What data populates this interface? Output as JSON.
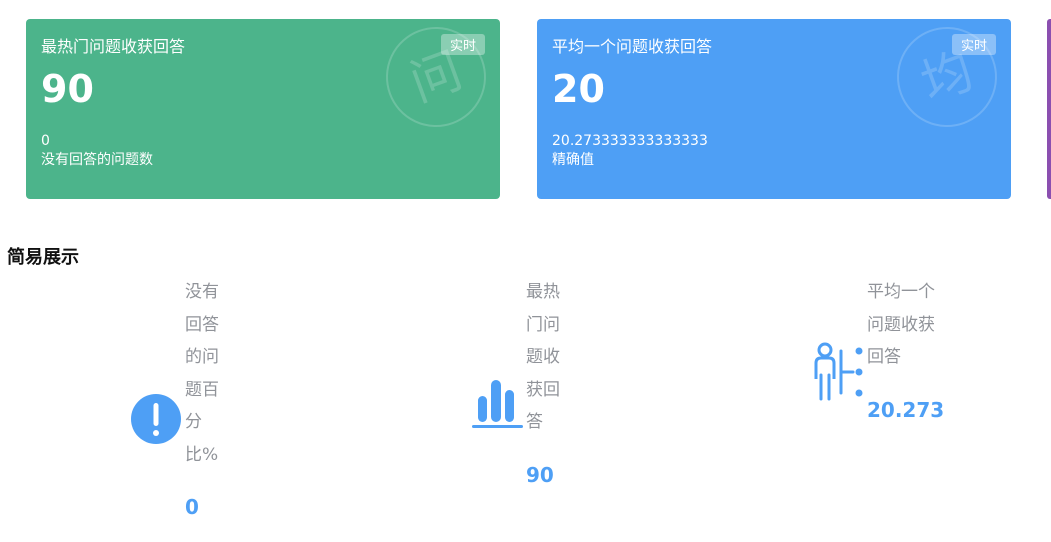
{
  "cards": [
    {
      "title": "最热门问题收获回答",
      "badge": "实时",
      "value": "90",
      "sub_value": "0",
      "sub_label": "没有回答的问题数",
      "watermark": "问",
      "color": "#4cb48b"
    },
    {
      "title": "平均一个问题收获回答",
      "badge": "实时",
      "value": "20",
      "sub_value": "20.273333333333333",
      "sub_label": "精确值",
      "watermark": "均",
      "color": "#4e9ff5"
    }
  ],
  "section": {
    "title": "简易展示"
  },
  "stats": [
    {
      "label": "没有回答的问题百分比%",
      "value": "0",
      "icon": "exclamation-circle-icon"
    },
    {
      "label": "最热门问题收获回答",
      "value": "90",
      "icon": "bar-chart-icon"
    },
    {
      "label": "平均一个问题收获回答",
      "value": "20.273",
      "icon": "person-list-icon"
    }
  ],
  "colors": {
    "green": "#4cb48b",
    "blue": "#4e9ff5",
    "purple_edge": "#8b4fb0",
    "muted": "#909399"
  }
}
